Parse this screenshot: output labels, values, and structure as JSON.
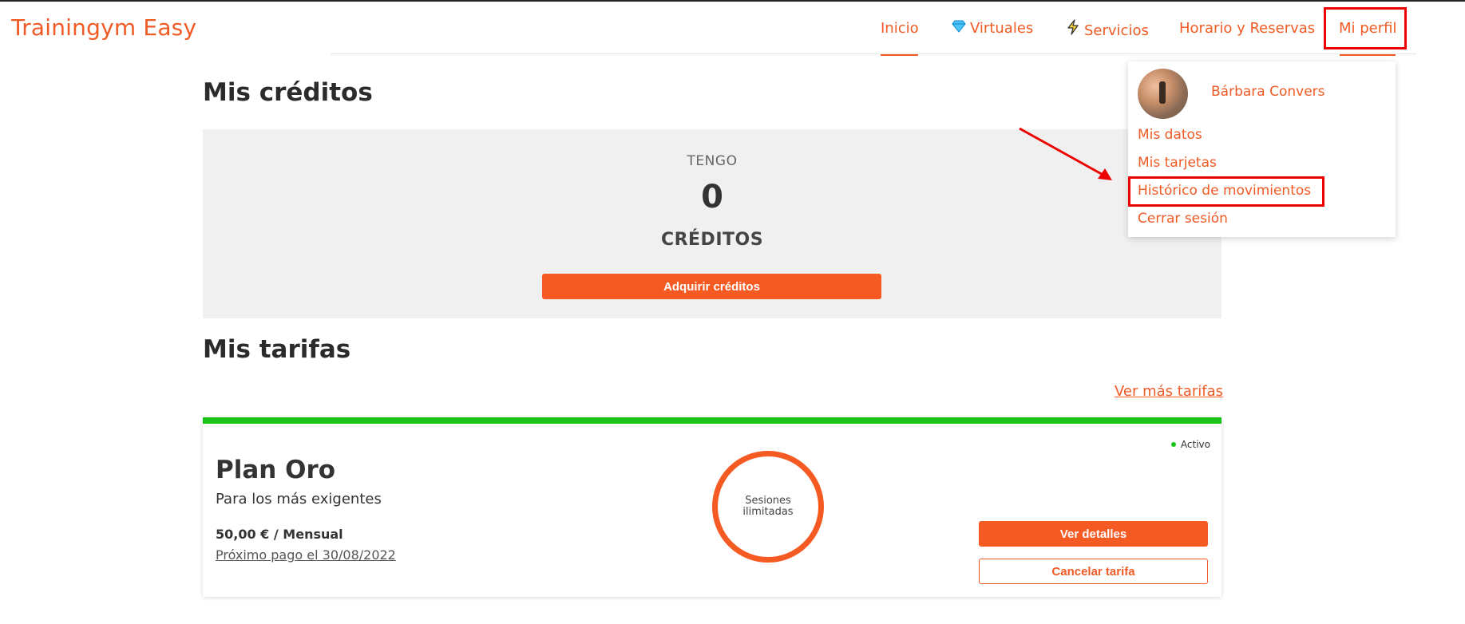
{
  "app": {
    "brand": "Trainingym Easy"
  },
  "nav": {
    "items": [
      {
        "label": "Inicio",
        "icon": ""
      },
      {
        "label": "Virtuales",
        "icon": "diamond-icon"
      },
      {
        "label": "Servicios",
        "icon": "lightning-icon"
      },
      {
        "label": "Horario y Reservas",
        "icon": ""
      },
      {
        "label": "Mi perfil",
        "icon": ""
      }
    ]
  },
  "credits": {
    "heading": "Mis créditos",
    "tengo": "TENGO",
    "value": "0",
    "unit": "CRÉDITOS",
    "button": "Adquirir créditos"
  },
  "tarifas": {
    "heading": "Mis tarifas",
    "more_link": "Ver más tarifas",
    "plan": {
      "name": "Plan Oro",
      "subtitle": "Para los más exigentes",
      "price": "50,00 € / Mensual",
      "next_payment": "Próximo pago el 30/08/2022",
      "sessions_line1": "Sesiones",
      "sessions_line2": "ilimitadas",
      "status": "Activo",
      "details_button": "Ver detalles",
      "cancel_button": "Cancelar tarifa"
    }
  },
  "profile_menu": {
    "user_name": "Bárbara Convers",
    "items": [
      "Mis datos",
      "Mis tarjetas",
      "Histórico de movimientos",
      "Cerrar sesión"
    ]
  },
  "colors": {
    "accent": "#f05a24",
    "button": "#f65a23",
    "active_bar": "#1ac41a",
    "annotation": "#ee0000"
  }
}
